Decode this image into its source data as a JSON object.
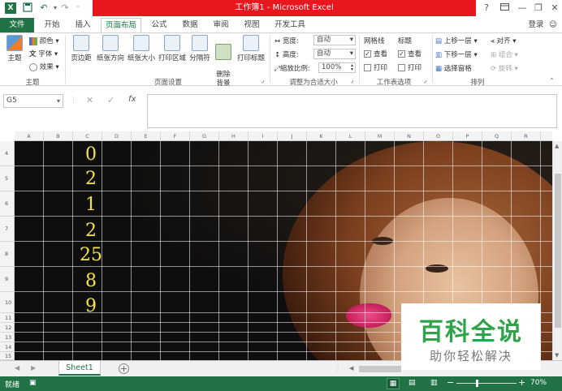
{
  "window": {
    "title": "工作簿1 -  Microsoft Excel",
    "help": "?",
    "login": "登录"
  },
  "ribbon_tabs": [
    "文件",
    "开始",
    "插入",
    "页面布局",
    "公式",
    "数据",
    "审阅",
    "视图",
    "开发工具"
  ],
  "ribbon": {
    "theme_group": {
      "label": "主题",
      "themes": "主题",
      "colors": "颜色",
      "fonts": "字体",
      "effects": "效果"
    },
    "page_setup_group": {
      "label": "页面设置",
      "buttons": [
        "页边距",
        "纸张方向",
        "纸张大小",
        "打印区域",
        "分隔符",
        "删除\n背景",
        "打印标题"
      ]
    },
    "scale_group": {
      "label": "调整为合适大小",
      "width_label": "宽度:",
      "width_value": "自动",
      "height_label": "高度:",
      "height_value": "自动",
      "scale_label": "缩放比例:",
      "scale_value": "100%"
    },
    "sheet_options_group": {
      "label": "工作表选项",
      "gridlines": "网格线",
      "headings": "标题",
      "view": "查看",
      "print": "打印"
    },
    "arrange_group": {
      "label": "排列",
      "bring_forward": "上移一层",
      "send_backward": "下移一层",
      "selection_pane": "选择窗格",
      "align": "对齐",
      "group": "组合",
      "rotate": "旋转"
    }
  },
  "formula_bar": {
    "name_box": "G5",
    "fx": "fx",
    "formula": ""
  },
  "grid": {
    "columns": [
      "A",
      "B",
      "C",
      "D",
      "E",
      "F",
      "G",
      "H",
      "I",
      "J",
      "K",
      "L",
      "M",
      "N",
      "O",
      "P",
      "Q",
      "R"
    ],
    "rows": [
      "4",
      "5",
      "6",
      "7",
      "8",
      "9",
      "10",
      "11",
      "12",
      "13",
      "14",
      "15"
    ],
    "column_c_values": [
      "0",
      "2",
      "1",
      "2",
      "25",
      "8",
      "9"
    ]
  },
  "sheet_tabs": {
    "active": "Sheet1",
    "add": "+"
  },
  "status_bar": {
    "ready": "就绪",
    "zoom": "70%"
  },
  "watermark": {
    "title": "百科全说",
    "subtitle": "助你轻松解决"
  },
  "colors": {
    "excel_green": "#217346",
    "title_red": "#e8161d",
    "number_yellow": "#f4e44a",
    "watermark_green": "#2fa34a"
  }
}
